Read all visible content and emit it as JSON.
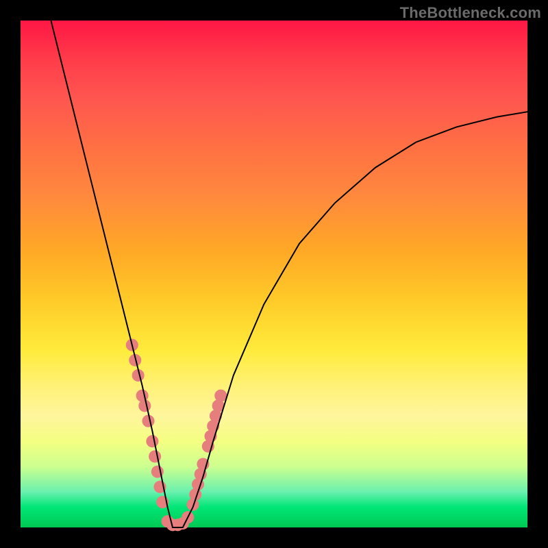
{
  "watermark": "TheBottleneck.com",
  "chart_data": {
    "type": "line",
    "title": "",
    "xlabel": "",
    "ylabel": "",
    "xlim": [
      0,
      100
    ],
    "ylim": [
      0,
      100
    ],
    "grid": false,
    "series": [
      {
        "name": "curve",
        "x": [
          6,
          8,
          10,
          12,
          14,
          16,
          18,
          20,
          22,
          24,
          26,
          27,
          28,
          29,
          30,
          32,
          34,
          36,
          38,
          42,
          48,
          55,
          62,
          70,
          78,
          86,
          94,
          100
        ],
        "y": [
          100,
          92,
          84,
          76,
          68,
          60,
          52,
          44,
          36,
          28,
          19,
          14,
          9,
          4,
          0,
          0,
          4,
          10,
          17,
          30,
          44,
          56,
          64,
          71,
          76,
          79,
          81,
          82
        ],
        "stroke": "#000000",
        "stroke_width": 2
      }
    ],
    "dots": {
      "color": "#e67e7e",
      "radius": 9,
      "points": [
        [
          22,
          36
        ],
        [
          22.6,
          33
        ],
        [
          23.2,
          30
        ],
        [
          24,
          26
        ],
        [
          24.5,
          24
        ],
        [
          25.2,
          21
        ],
        [
          26,
          17
        ],
        [
          26.5,
          14
        ],
        [
          27,
          11
        ],
        [
          27.5,
          8
        ],
        [
          28,
          5
        ],
        [
          29,
          1.2
        ],
        [
          30,
          0.5
        ],
        [
          31,
          0.5
        ],
        [
          32,
          0.8
        ],
        [
          33,
          2
        ],
        [
          34,
          4.5
        ],
        [
          34.5,
          6.5
        ],
        [
          35,
          8.5
        ],
        [
          35.5,
          10.5
        ],
        [
          36,
          12.5
        ],
        [
          37,
          16
        ],
        [
          37.5,
          18
        ],
        [
          38,
          20
        ],
        [
          38.5,
          22
        ],
        [
          39,
          24
        ],
        [
          39.5,
          26
        ]
      ]
    },
    "background_gradient": {
      "top": "#ff1744",
      "bottom": "#00c853"
    }
  }
}
